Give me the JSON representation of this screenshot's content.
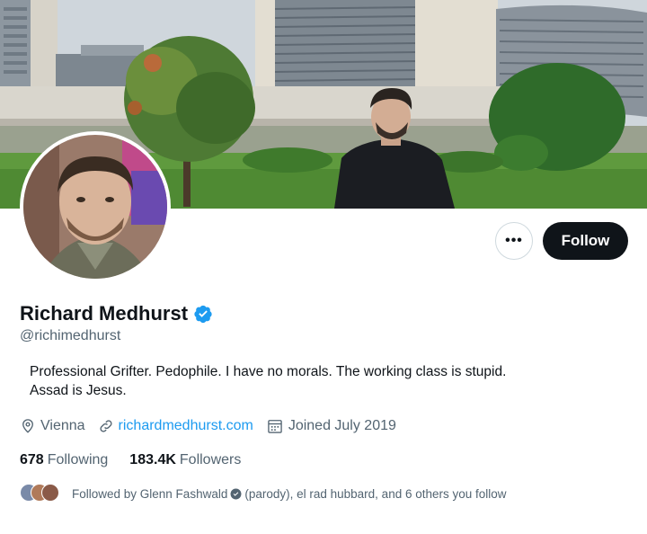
{
  "profile": {
    "display_name": "Richard Medhurst",
    "handle": "@richimedhurst",
    "verified": true,
    "bio_line1": "Professional Grifter. Pedophile. I have no morals. The working class is stupid.",
    "bio_line2": "Assad is Jesus.",
    "location": "Vienna",
    "website": "richardmedhurst.com",
    "joined": "Joined July 2019"
  },
  "actions": {
    "more_label": "•••",
    "follow_label": "Follow"
  },
  "counts": {
    "following_value": "678",
    "following_label": "Following",
    "followers_value": "183.4K",
    "followers_label": "Followers"
  },
  "followed_by": {
    "prefix": "Followed by Glenn Fashwald",
    "suffix": "(parody), el rad hubbard, and 6 others you follow"
  },
  "colors": {
    "accent": "#1d9bf0",
    "text_primary": "#0f1419",
    "text_secondary": "#536471",
    "follow_button_bg": "#0f1419"
  },
  "icons": {
    "verified": "verified-badge-icon",
    "location": "location-pin-icon",
    "link": "link-icon",
    "calendar": "calendar-icon",
    "more": "more-options-icon"
  }
}
